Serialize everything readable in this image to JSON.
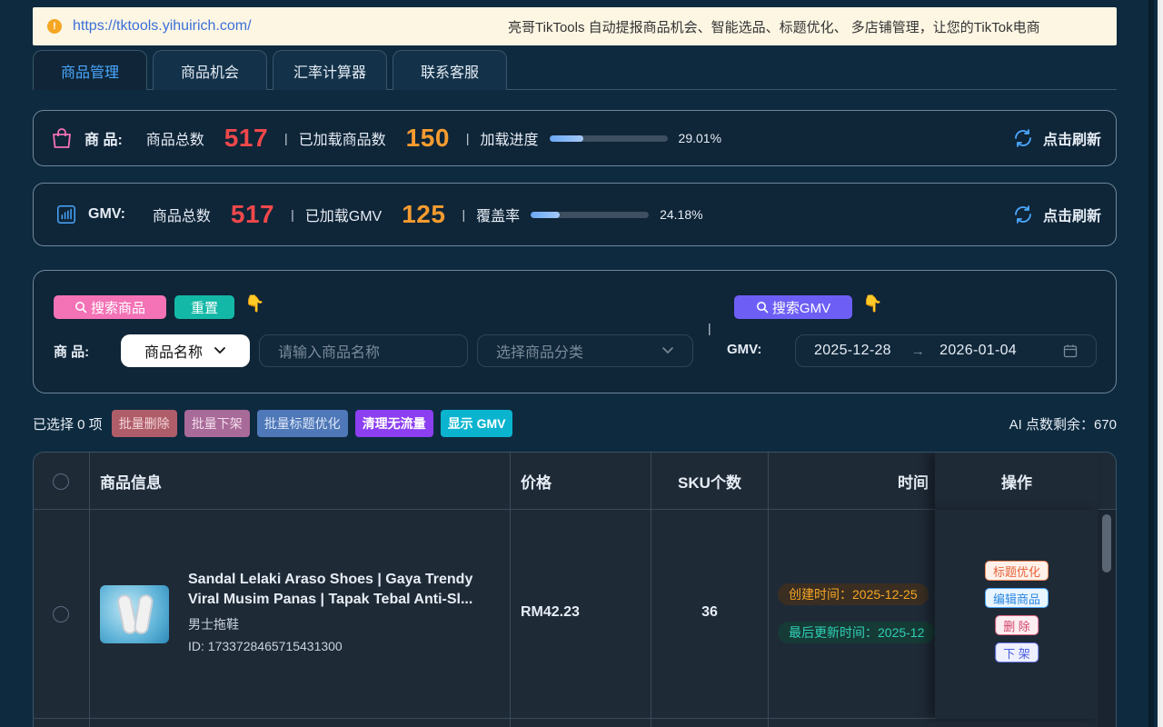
{
  "notice": {
    "url": "https://tktools.yihuirich.com/",
    "message": "亮哥TikTools 自动提报商品机会、智能选品、标题优化、 多店铺管理，让您的TikTok电商"
  },
  "tabs": [
    {
      "label": "商品管理",
      "active": true
    },
    {
      "label": "商品机会",
      "active": false
    },
    {
      "label": "汇率计算器",
      "active": false
    },
    {
      "label": "联系客服",
      "active": false
    }
  ],
  "product_stats": {
    "label": "商 品:",
    "total_label": "商品总数",
    "total": "517",
    "loaded_label": "已加载商品数",
    "loaded": "150",
    "progress_label": "加载进度",
    "progress_pct": "29.01%",
    "progress_value": 29.01,
    "refresh_label": "点击刷新"
  },
  "gmv_stats": {
    "label": "GMV:",
    "total_label": "商品总数",
    "total": "517",
    "loaded_label": "已加载GMV",
    "loaded": "125",
    "coverage_label": "覆盖率",
    "coverage_pct": "24.18%",
    "coverage_value": 24.18,
    "refresh_label": "点击刷新"
  },
  "search": {
    "search_button": "搜索商品",
    "reset_button": "重置",
    "gmv_search_button": "搜索GMV",
    "product_label": "商 品:",
    "field_select": "商品名称",
    "name_placeholder": "请输入商品名称",
    "category_placeholder": "选择商品分类",
    "pipe": "|",
    "gmv_label": "GMV:",
    "date_start": "2025-12-28",
    "date_arrow": "→",
    "date_end": "2026-01-04"
  },
  "bulk": {
    "selected_text": "已选择 0 项",
    "delete": "批量删除",
    "offline": "批量下架",
    "title_opt": "批量标题优化",
    "clean": "清理无流量",
    "show_gmv": "显示 GMV",
    "ai_points": "AI 点数剩余：670"
  },
  "table": {
    "headers": {
      "info": "商品信息",
      "price": "价格",
      "sku": "SKU个数",
      "time": "时间",
      "ops": "操作"
    },
    "rows": [
      {
        "title_line1": "Sandal Lelaki Araso Shoes | Gaya Trendy",
        "title_line2": "Viral Musim Panas | Tapak Tebal Anti-Sl...",
        "category": "男士拖鞋",
        "id": "ID: 1733728465715431300",
        "price": "RM42.23",
        "sku": "36",
        "created": "创建时间：2025-12-25",
        "updated": "最后更新时间：2025-12",
        "ops": {
          "optimize": "标题优化",
          "edit": "编辑商品",
          "delete": "删 除",
          "offline": "下 架"
        }
      }
    ]
  },
  "colors": {
    "accent_blue": "#4aa8ff",
    "total_red": "#f0484b",
    "loaded_orange": "#f59b2f",
    "background": "#0e2a3f"
  },
  "icons": [
    "warning-icon",
    "shopping-bag-icon",
    "chart-icon",
    "refresh-icon",
    "search-icon",
    "pointing-hand-icon",
    "chevron-down-icon",
    "calendar-icon"
  ]
}
